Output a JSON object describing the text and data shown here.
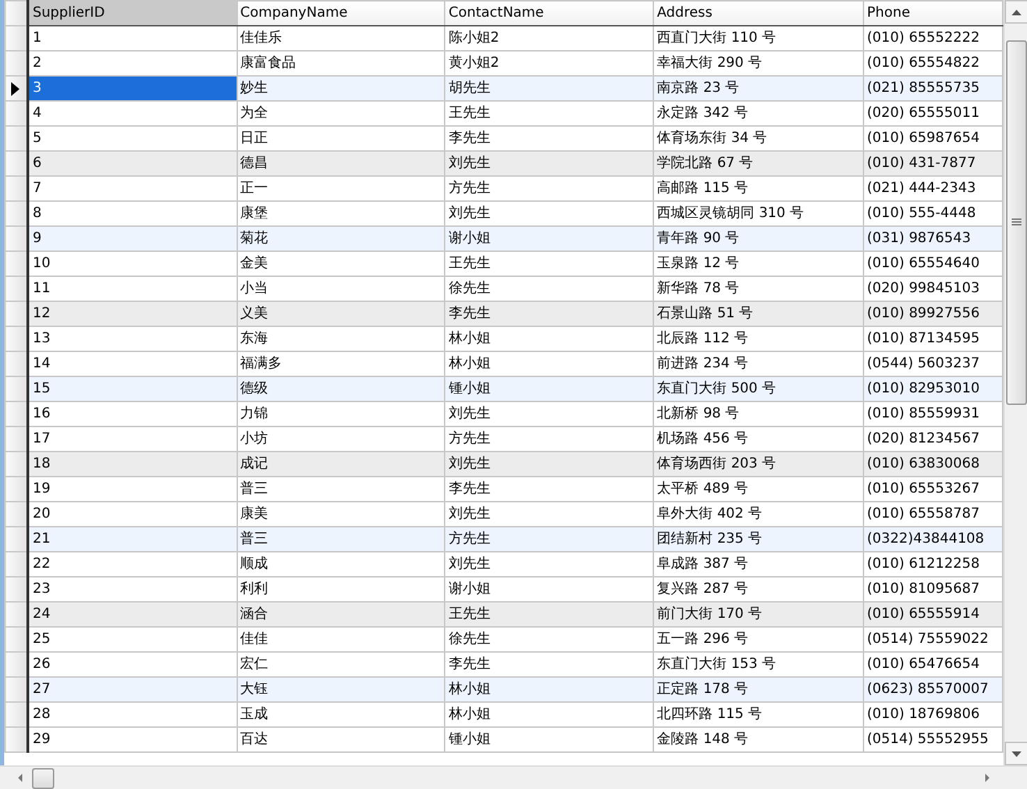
{
  "columns": [
    {
      "label": "SupplierID",
      "selected": true
    },
    {
      "label": "CompanyName",
      "selected": false
    },
    {
      "label": "ContactName",
      "selected": false
    },
    {
      "label": "Address",
      "selected": false
    },
    {
      "label": "Phone",
      "selected": false
    }
  ],
  "rows": [
    {
      "cells": [
        "1",
        "佳佳乐",
        "陈小姐2",
        "西直门大街 110 号",
        "(010) 65552222"
      ],
      "selected": false
    },
    {
      "cells": [
        "2",
        "康富食品",
        "黄小姐2",
        "幸福大街 290 号",
        "(010) 65554822"
      ],
      "selected": false
    },
    {
      "cells": [
        "3",
        "妙生",
        "胡先生",
        "南京路 23 号",
        "(021) 85555735"
      ],
      "selected": true,
      "color": "#edf4fd"
    },
    {
      "cells": [
        "4",
        "为全",
        "王先生",
        "永定路 342 号",
        "(020) 65555011"
      ],
      "selected": false
    },
    {
      "cells": [
        "5",
        "日正",
        "李先生",
        "体育场东街 34 号",
        "(010) 65987654"
      ],
      "selected": false
    },
    {
      "cells": [
        "6",
        "德昌",
        "刘先生",
        "学院北路 67 号",
        "(010) 431-7877"
      ],
      "selected": false,
      "color": "#ececec"
    },
    {
      "cells": [
        "7",
        "正一",
        "方先生",
        "高邮路 115 号",
        "(021) 444-2343"
      ],
      "selected": false
    },
    {
      "cells": [
        "8",
        "康堡",
        "刘先生",
        "西城区灵镜胡同 310 号",
        "(010) 555-4448"
      ],
      "selected": false
    },
    {
      "cells": [
        "9",
        "菊花",
        "谢小姐",
        "青年路 90 号",
        "(031) 9876543"
      ],
      "selected": false,
      "color": "#edf4fd"
    },
    {
      "cells": [
        "10",
        "金美",
        "王先生",
        "玉泉路 12 号",
        "(010) 65554640"
      ],
      "selected": false
    },
    {
      "cells": [
        "11",
        "小当",
        "徐先生",
        "新华路 78 号",
        "(020) 99845103"
      ],
      "selected": false
    },
    {
      "cells": [
        "12",
        "义美",
        "李先生",
        "石景山路 51 号",
        "(010) 89927556"
      ],
      "selected": false,
      "color": "#ececec"
    },
    {
      "cells": [
        "13",
        "东海",
        "林小姐",
        "北辰路 112 号",
        "(010) 87134595"
      ],
      "selected": false
    },
    {
      "cells": [
        "14",
        "福满多",
        "林小姐",
        "前进路 234 号",
        "(0544) 5603237"
      ],
      "selected": false
    },
    {
      "cells": [
        "15",
        "德级",
        "锺小姐",
        "东直门大街 500 号",
        "(010) 82953010"
      ],
      "selected": false,
      "color": "#edf4fd"
    },
    {
      "cells": [
        "16",
        "力锦",
        "刘先生",
        "北新桥 98 号",
        "(010) 85559931"
      ],
      "selected": false
    },
    {
      "cells": [
        "17",
        "小坊",
        "方先生",
        "机场路 456 号",
        "(020) 81234567"
      ],
      "selected": false
    },
    {
      "cells": [
        "18",
        "成记",
        "刘先生",
        "体育场西街 203 号",
        "(010) 63830068"
      ],
      "selected": false,
      "color": "#ececec"
    },
    {
      "cells": [
        "19",
        "普三",
        "李先生",
        "太平桥 489 号",
        "(010) 65553267"
      ],
      "selected": false
    },
    {
      "cells": [
        "20",
        "康美",
        "刘先生",
        "阜外大街 402 号",
        "(010) 65558787"
      ],
      "selected": false
    },
    {
      "cells": [
        "21",
        "普三",
        "方先生",
        "团结新村 235 号",
        "(0322)43844108"
      ],
      "selected": false,
      "color": "#edf4fd"
    },
    {
      "cells": [
        "22",
        "顺成",
        "刘先生",
        "阜成路 387 号",
        "(010) 61212258"
      ],
      "selected": false
    },
    {
      "cells": [
        "23",
        "利利",
        "谢小姐",
        "复兴路 287 号",
        "(010) 81095687"
      ],
      "selected": false
    },
    {
      "cells": [
        "24",
        "涵合",
        "王先生",
        "前门大街 170 号",
        "(010) 65555914"
      ],
      "selected": false,
      "color": "#ececec"
    },
    {
      "cells": [
        "25",
        "佳佳",
        "徐先生",
        "五一路 296 号",
        "(0514) 75559022"
      ],
      "selected": false
    },
    {
      "cells": [
        "26",
        "宏仁",
        "李先生",
        "东直门大街 153 号",
        "(010) 65476654"
      ],
      "selected": false
    },
    {
      "cells": [
        "27",
        "大钰",
        "林小姐",
        "正定路 178 号",
        "(0623) 85570007"
      ],
      "selected": false,
      "color": "#edf4fd"
    },
    {
      "cells": [
        "28",
        "玉成",
        "林小姐",
        "北四环路 115 号",
        "(010) 18769806"
      ],
      "selected": false
    },
    {
      "cells": [
        "29",
        "百达",
        "锺小姐",
        "金陵路 148 号",
        "(0514) 55552955"
      ],
      "selected": false
    }
  ]
}
